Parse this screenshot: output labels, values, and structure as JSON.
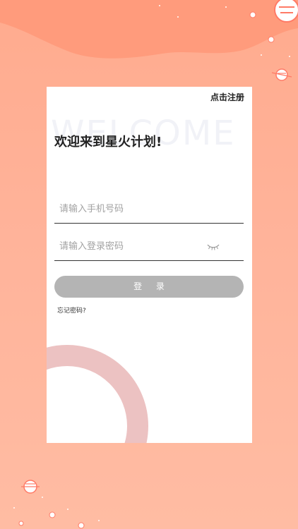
{
  "header": {
    "register_label": "点击注册"
  },
  "welcome_watermark": "WELCOME",
  "title": "欢迎来到星火计划!",
  "form": {
    "phone_placeholder": "请输入手机号码",
    "password_placeholder": "请输入登录密码",
    "password_toggle_icon": "eye-closed-icon",
    "login_label": "登 录",
    "forgot_label": "忘记密码?"
  },
  "colors": {
    "background": "#ffb39a",
    "card": "#ffffff",
    "login_button": "#b4b4b4",
    "ring": "#ecc2c2"
  }
}
